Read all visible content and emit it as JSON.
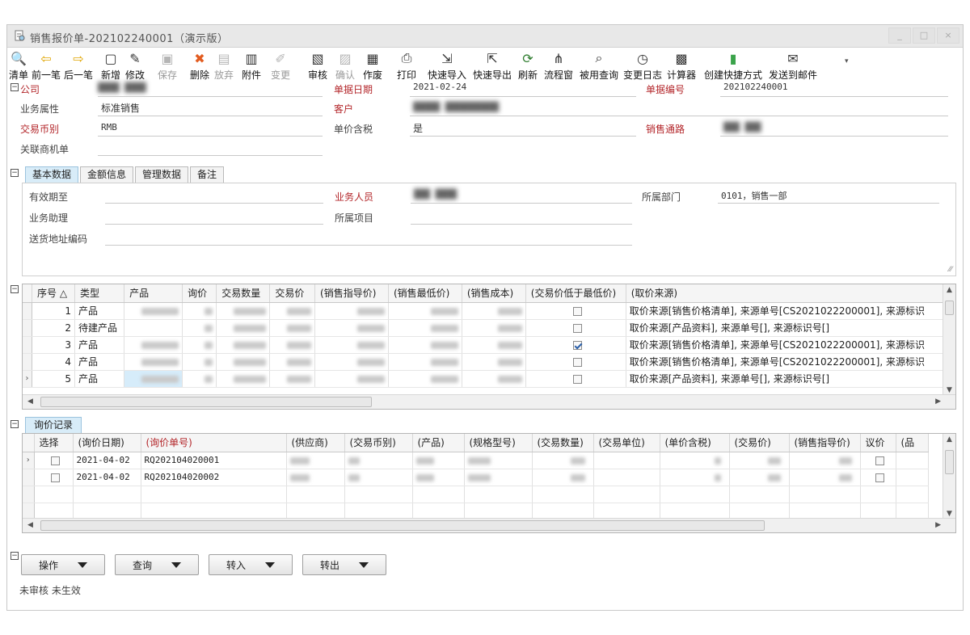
{
  "window": {
    "title": "销售报价单-202102240001（演示版）",
    "controls": [
      "_",
      "□",
      "×"
    ]
  },
  "toolbar": [
    {
      "label": "清单",
      "icon": "list-search-icon",
      "enabled": true
    },
    {
      "label": "前一笔",
      "icon": "arrow-left-icon",
      "enabled": true
    },
    {
      "label": "后一笔",
      "icon": "arrow-right-icon",
      "enabled": true
    },
    {
      "label": "新增",
      "icon": "new-document-icon",
      "enabled": true
    },
    {
      "label": "修改",
      "icon": "edit-icon",
      "enabled": true
    },
    {
      "label": "保存",
      "icon": "save-icon",
      "enabled": false
    },
    {
      "label": "删除",
      "icon": "delete-icon",
      "enabled": true
    },
    {
      "label": "放弃",
      "icon": "discard-icon",
      "enabled": false
    },
    {
      "label": "附件",
      "icon": "attachment-icon",
      "enabled": true
    },
    {
      "label": "变更",
      "icon": "change-icon",
      "enabled": false
    },
    {
      "label": "审核",
      "icon": "audit-icon",
      "enabled": true
    },
    {
      "label": "确认",
      "icon": "confirm-icon",
      "enabled": false
    },
    {
      "label": "作废",
      "icon": "void-icon",
      "enabled": true
    },
    {
      "label": "打印",
      "icon": "print-icon",
      "enabled": true
    },
    {
      "label": "快速导入",
      "icon": "quick-import-icon",
      "enabled": true
    },
    {
      "label": "快速导出",
      "icon": "quick-export-icon",
      "enabled": true
    },
    {
      "label": "刷新",
      "icon": "refresh-icon",
      "enabled": true
    },
    {
      "label": "流程窗",
      "icon": "workflow-icon",
      "enabled": true
    },
    {
      "label": "被用查询",
      "icon": "usage-query-icon",
      "enabled": true
    },
    {
      "label": "变更日志",
      "icon": "change-log-icon",
      "enabled": true
    },
    {
      "label": "计算器",
      "icon": "calculator-icon",
      "enabled": true
    },
    {
      "label": "创建快捷方式",
      "icon": "shortcut-icon",
      "enabled": true
    },
    {
      "label": "发送到邮件",
      "icon": "mail-icon",
      "enabled": true
    }
  ],
  "header": {
    "company_label": "公司",
    "business_type_label": "业务属性",
    "business_type_value": "标准销售",
    "currency_label": "交易币别",
    "currency_value": "RMB",
    "opportunity_label": "关联商机单",
    "doc_date_label": "单据日期",
    "doc_date_value": "2021-02-24",
    "customer_label": "客户",
    "tax_included_label": "单价含税",
    "tax_included_value": "是",
    "doc_no_label": "单据编号",
    "doc_no_value": "202102240001",
    "channel_label": "销售通路"
  },
  "tabs": [
    "基本数据",
    "金额信息",
    "管理数据",
    "备注"
  ],
  "basic": {
    "valid_until_label": "有效期至",
    "sales_person_label": "业务人员",
    "department_label": "所属部门",
    "department_value": "0101，销售一部",
    "assistant_label": "业务助理",
    "project_label": "所属项目",
    "address_code_label": "送货地址编码"
  },
  "detail_grid": {
    "columns": [
      "序号 △",
      "类型",
      "产品",
      "询价",
      "交易数量",
      "交易价",
      "(销售指导价)",
      "(销售最低价)",
      "(销售成本)",
      "(交易价低于最低价)",
      "(取价来源)"
    ],
    "rows": [
      {
        "no": "1",
        "type": "产品",
        "below_min": false,
        "source": "取价来源[销售价格清单], 来源单号[CS2021022200001], 来源标识"
      },
      {
        "no": "2",
        "type": "待建产品",
        "below_min": false,
        "source": "取价来源[产品资料], 来源单号[], 来源标识号[]"
      },
      {
        "no": "3",
        "type": "产品",
        "below_min": true,
        "source": "取价来源[销售价格清单], 来源单号[CS2021022200001], 来源标识"
      },
      {
        "no": "4",
        "type": "产品",
        "below_min": false,
        "source": "取价来源[销售价格清单], 来源单号[CS2021022200001], 来源标识"
      },
      {
        "no": "5",
        "type": "产品",
        "below_min": false,
        "source": "取价来源[产品资料], 来源单号[], 来源标识号[]"
      }
    ]
  },
  "inquiry": {
    "tab_label": "询价记录",
    "columns": [
      "选择",
      "(询价日期)",
      "(询价单号)",
      "(供应商)",
      "(交易币别)",
      "(产品)",
      "(规格型号)",
      "(交易数量)",
      "(交易单位)",
      "(单价含税)",
      "(交易价)",
      "(销售指导价)",
      "议价",
      "(品"
    ],
    "rows": [
      {
        "date": "2021-04-02",
        "no": "RQ202104020001"
      },
      {
        "date": "2021-04-02",
        "no": "RQ202104020002"
      }
    ]
  },
  "actions": [
    "操作",
    "查询",
    "转入",
    "转出"
  ],
  "status": "未审核 未生效",
  "colors": {
    "required": "#b3262a",
    "tab_active": "#d8ecf8",
    "selection": "#d6ecfa"
  }
}
